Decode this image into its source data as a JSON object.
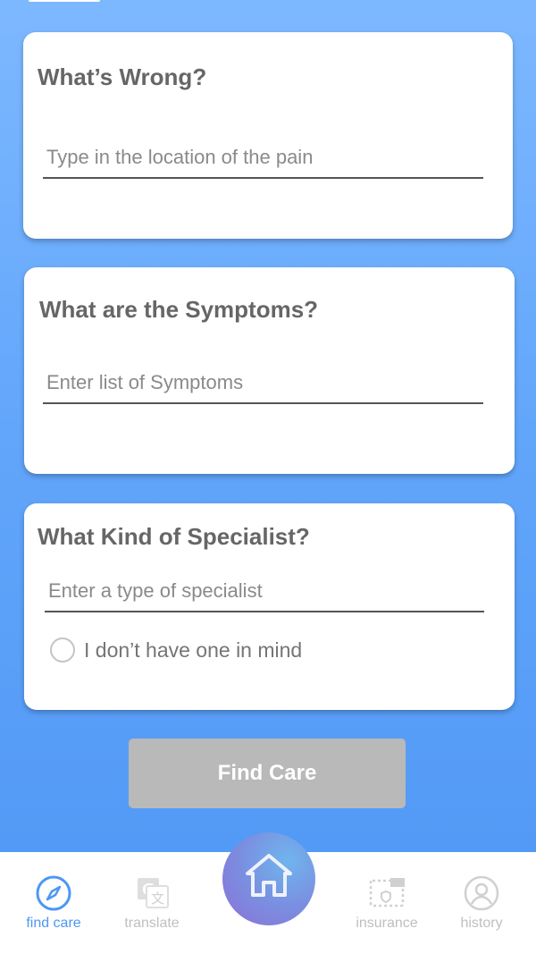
{
  "cards": {
    "wrong": {
      "title": "What’s Wrong?",
      "input_placeholder": "Type in the location of the pain",
      "input_value": ""
    },
    "symptoms": {
      "title": "What are the Symptoms?",
      "input_placeholder": "Enter list of Symptoms",
      "input_value": ""
    },
    "specialist": {
      "title": "What Kind of Specialist?",
      "input_placeholder": "Enter a type of specialist",
      "input_value": "",
      "option_label": "I don’t have one in mind",
      "option_checked": false
    }
  },
  "find_care_button": "Find Care",
  "nav": {
    "items": [
      {
        "label": "find care",
        "icon": "compass-icon",
        "active": true
      },
      {
        "label": "translate",
        "icon": "translate-icon",
        "active": false
      },
      {
        "label": "home",
        "icon": "home-icon",
        "active": false
      },
      {
        "label": "insurance",
        "icon": "insurance-card-icon",
        "active": false
      },
      {
        "label": "history",
        "icon": "user-history-icon",
        "active": false
      }
    ]
  },
  "colors": {
    "background_top": "#7db8ff",
    "background_bottom": "#4f97f5",
    "accent": "#4d97f3",
    "button_disabled": "#b9b9b9",
    "inactive": "#bfbfbf"
  }
}
